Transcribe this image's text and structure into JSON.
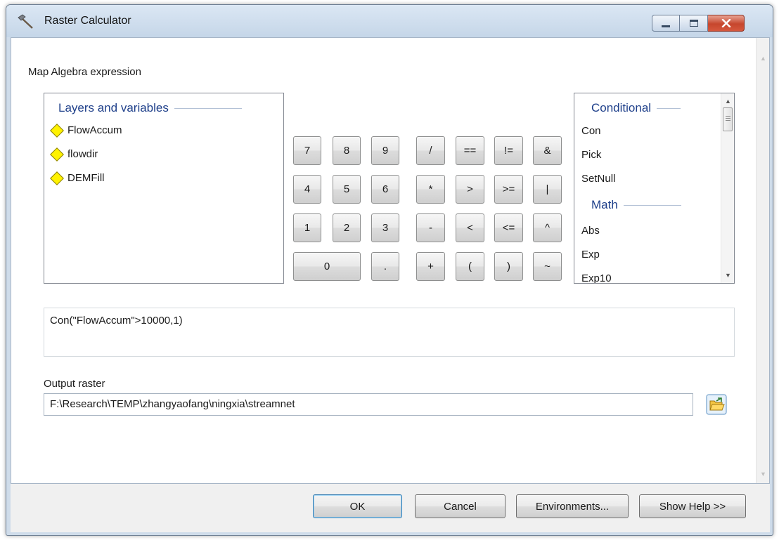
{
  "window": {
    "title": "Raster Calculator"
  },
  "expression_label": "Map Algebra expression",
  "layers": {
    "header": "Layers and variables",
    "items": [
      "FlowAccum",
      "flowdir",
      "DEMFill"
    ]
  },
  "keypad": {
    "row1": [
      "7",
      "8",
      "9",
      "/",
      "==",
      "!=",
      "&"
    ],
    "row2": [
      "4",
      "5",
      "6",
      "*",
      ">",
      ">=",
      "|"
    ],
    "row3": [
      "1",
      "2",
      "3",
      "-",
      "<",
      "<=",
      "^"
    ],
    "row4": [
      "0",
      ".",
      "+",
      "(",
      ")",
      "~"
    ]
  },
  "functions": {
    "conditional_header": "Conditional",
    "conditional": [
      "Con",
      "Pick",
      "SetNull"
    ],
    "math_header": "Math",
    "math": [
      "Abs",
      "Exp",
      "Exp10"
    ]
  },
  "expression": "Con(\"FlowAccum\">10000,1)",
  "output": {
    "label": "Output raster",
    "value": "F:\\Research\\TEMP\\zhangyaofang\\ningxia\\streamnet"
  },
  "buttons": {
    "ok": "OK",
    "cancel": "Cancel",
    "environments": "Environments...",
    "help": "Show Help >>"
  }
}
